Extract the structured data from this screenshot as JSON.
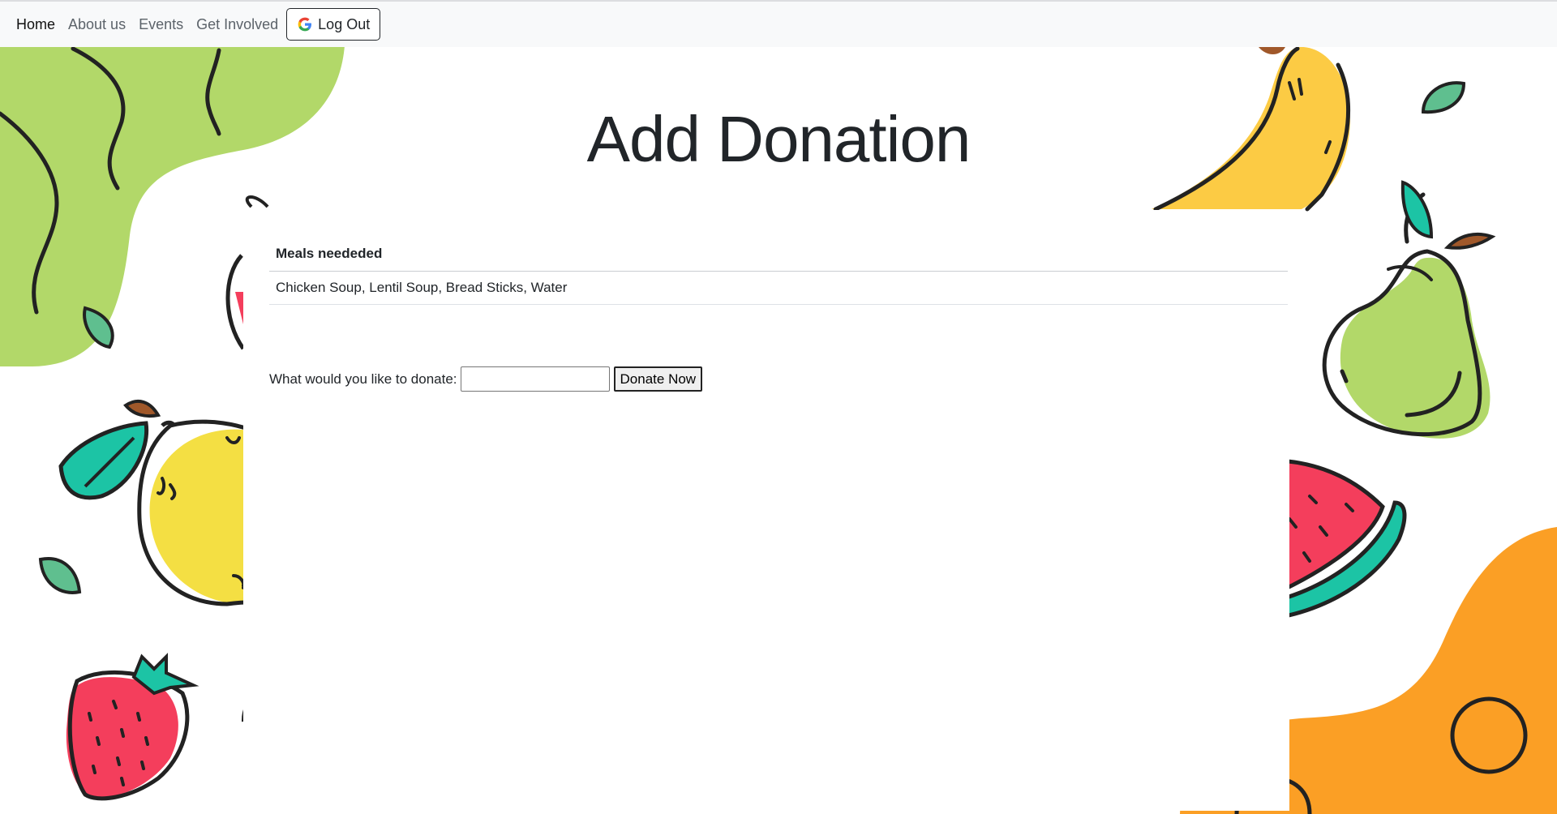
{
  "nav": {
    "items": [
      {
        "label": "Home"
      },
      {
        "label": "About us"
      },
      {
        "label": "Events"
      },
      {
        "label": "Get Involved"
      }
    ],
    "logout_label": "Log Out"
  },
  "page": {
    "title": "Add Donation"
  },
  "meals_table": {
    "header": "Meals neededed",
    "rows": [
      "Chicken Soup, Lentil Soup, Bread Sticks, Water"
    ]
  },
  "donate_form": {
    "label": "What would you like to donate:",
    "input_value": "",
    "button_label": "Donate Now"
  },
  "colors": {
    "nav_bg": "#f8f9fa",
    "green_blob": "#b2d869",
    "orange_blob": "#fb9f25",
    "banana": "#fccb44",
    "lemon": "#f4df43",
    "teal": "#1cc4a5",
    "red": "#f43e5c"
  }
}
